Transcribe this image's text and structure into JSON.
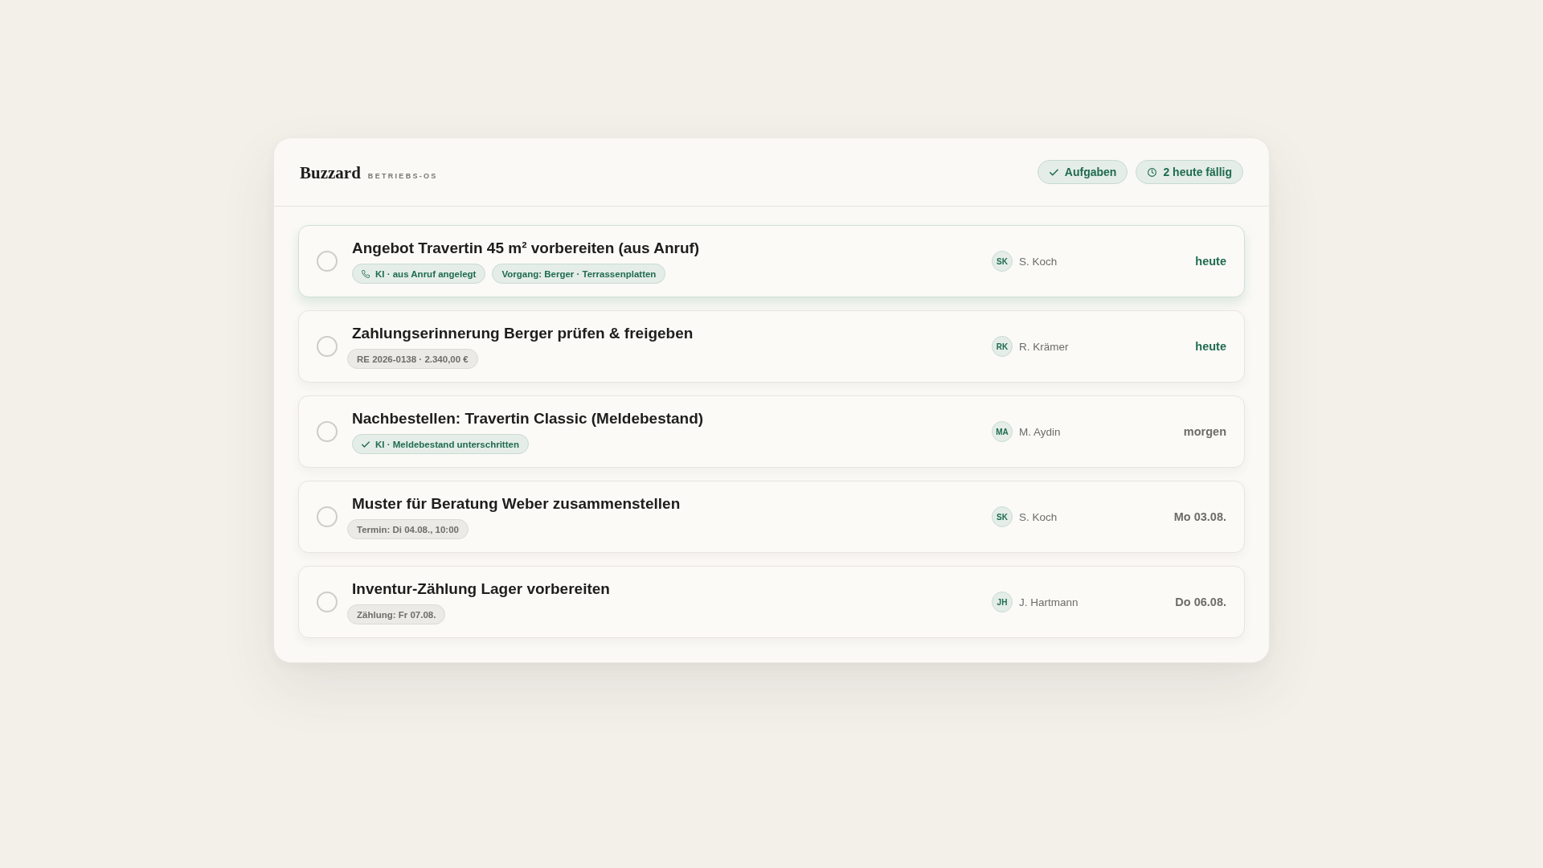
{
  "header": {
    "brand": "Buzzard",
    "subtitle": "BETRIEBS-OS",
    "chips": [
      {
        "kind": "tasks",
        "label": "Aufgaben"
      },
      {
        "kind": "due",
        "label": "2 heute fällig"
      }
    ]
  },
  "tasks": [
    {
      "title": "Angebot Travertin 45 m² vorbereiten (aus Anruf)",
      "checked": false,
      "selected": true,
      "tags": [
        {
          "kind": "call",
          "label": "KI · aus Anruf angelegt"
        },
        {
          "kind": "reference",
          "label": "Vorgang: Berger · Terrassenplatten"
        }
      ],
      "assignee": {
        "initials": "SK",
        "name": "S. Koch"
      },
      "due": {
        "label": "heute",
        "urgent": true
      }
    },
    {
      "title": "Zahlungserinnerung Berger prüfen & freigeben",
      "checked": false,
      "selected": false,
      "tags": [
        {
          "kind": "meta",
          "label": "RE 2026-0138 · 2.340,00 €"
        }
      ],
      "assignee": {
        "initials": "RK",
        "name": "R. Krämer"
      },
      "due": {
        "label": "heute",
        "urgent": true
      }
    },
    {
      "title": "Nachbestellen: Travertin Classic (Meldebestand)",
      "checked": false,
      "selected": false,
      "tags": [
        {
          "kind": "confirm",
          "label": "KI · Meldebestand unterschritten"
        }
      ],
      "assignee": {
        "initials": "MA",
        "name": "M. Aydin"
      },
      "due": {
        "label": "morgen",
        "urgent": false
      }
    },
    {
      "title": "Muster für Beratung Weber zusammenstellen",
      "checked": false,
      "selected": false,
      "tags": [
        {
          "kind": "meta",
          "label": "Termin: Di 04.08., 10:00"
        }
      ],
      "assignee": {
        "initials": "SK",
        "name": "S. Koch"
      },
      "due": {
        "label": "Mo 03.08.",
        "urgent": false
      }
    },
    {
      "title": "Inventur-Zählung Lager vorbereiten",
      "checked": false,
      "selected": false,
      "tags": [
        {
          "kind": "meta",
          "label": "Zählung: Fr 07.08."
        }
      ],
      "assignee": {
        "initials": "JH",
        "name": "J. Hartmann"
      },
      "due": {
        "label": "Do 06.08.",
        "urgent": false
      }
    }
  ]
}
